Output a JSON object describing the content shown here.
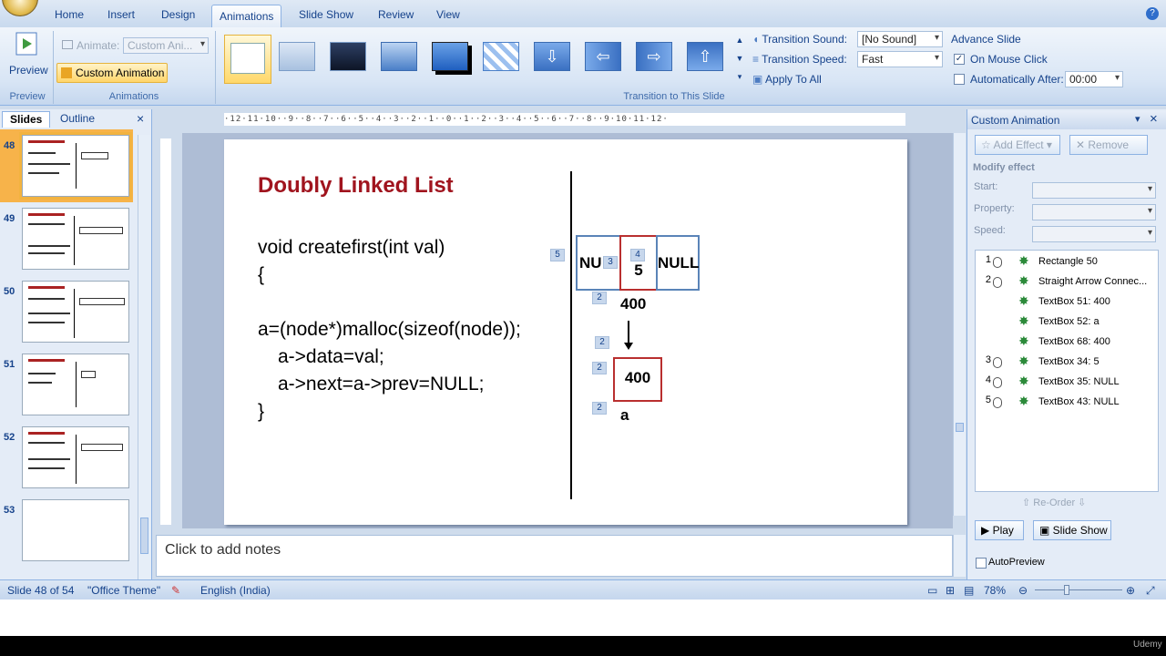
{
  "tabs": [
    "Home",
    "Insert",
    "Design",
    "Animations",
    "Slide Show",
    "Review",
    "View"
  ],
  "ribbon": {
    "preview_label": "Preview",
    "animate_label": "Animate:",
    "animate_value": "Custom Ani...",
    "custom_animation_label": "Custom Animation",
    "group_preview": "Preview",
    "group_animations": "Animations",
    "group_transition": "Transition to This Slide",
    "transition_sound_label": "Transition Sound:",
    "transition_sound_value": "[No Sound]",
    "transition_speed_label": "Transition Speed:",
    "transition_speed_value": "Fast",
    "apply_to_all": "Apply To All",
    "advance_slide": "Advance Slide",
    "on_mouse_click": "On Mouse Click",
    "automatically_after": "Automatically After:",
    "automatically_after_value": "00:00"
  },
  "left_panel": {
    "tab_slides": "Slides",
    "tab_outline": "Outline",
    "close": "×",
    "slide_numbers": [
      "48",
      "49",
      "50",
      "51",
      "52",
      "53"
    ]
  },
  "slide": {
    "title": "Doubly Linked List",
    "code": [
      "void createfirst(int val)",
      "{",
      "a=(node*)malloc(sizeof(node));",
      "a->data=val;",
      "a->next=a->prev=NULL;",
      "}"
    ],
    "cells": {
      "left": "NU",
      "mid": "5",
      "right": "NULL"
    },
    "address_top": "400",
    "box_value": "400",
    "pointer_label": "a",
    "tags": {
      "t5": "5",
      "t3": "3",
      "t4": "4",
      "t2a": "2",
      "t2b": "2",
      "t2c": "2",
      "t2d": "2"
    }
  },
  "notes_placeholder": "Click to add notes",
  "custom_animation": {
    "title": "Custom Animation",
    "add_effect": "Add Effect",
    "remove": "Remove",
    "modify_effect": "Modify effect",
    "start_label": "Start:",
    "property_label": "Property:",
    "speed_label": "Speed:",
    "items": [
      {
        "num": "1",
        "name": "Rectangle 50",
        "mouse": true
      },
      {
        "num": "2",
        "name": "Straight Arrow Connec...",
        "mouse": true
      },
      {
        "num": "",
        "name": "TextBox 51: 400",
        "mouse": false
      },
      {
        "num": "",
        "name": "TextBox 52: a",
        "mouse": false
      },
      {
        "num": "",
        "name": "TextBox 68: 400",
        "mouse": false
      },
      {
        "num": "3",
        "name": "TextBox 34: 5",
        "mouse": true
      },
      {
        "num": "4",
        "name": "TextBox 35: NULL",
        "mouse": true
      },
      {
        "num": "5",
        "name": "TextBox 43: NULL",
        "mouse": true
      }
    ],
    "reorder": "Re-Order",
    "play": "Play",
    "slide_show": "Slide Show",
    "autopreview": "AutoPreview"
  },
  "status": {
    "slide_info": "Slide 48 of 54",
    "theme": "\"Office Theme\"",
    "language": "English (India)",
    "zoom": "78%"
  },
  "watermark": "Udemy"
}
